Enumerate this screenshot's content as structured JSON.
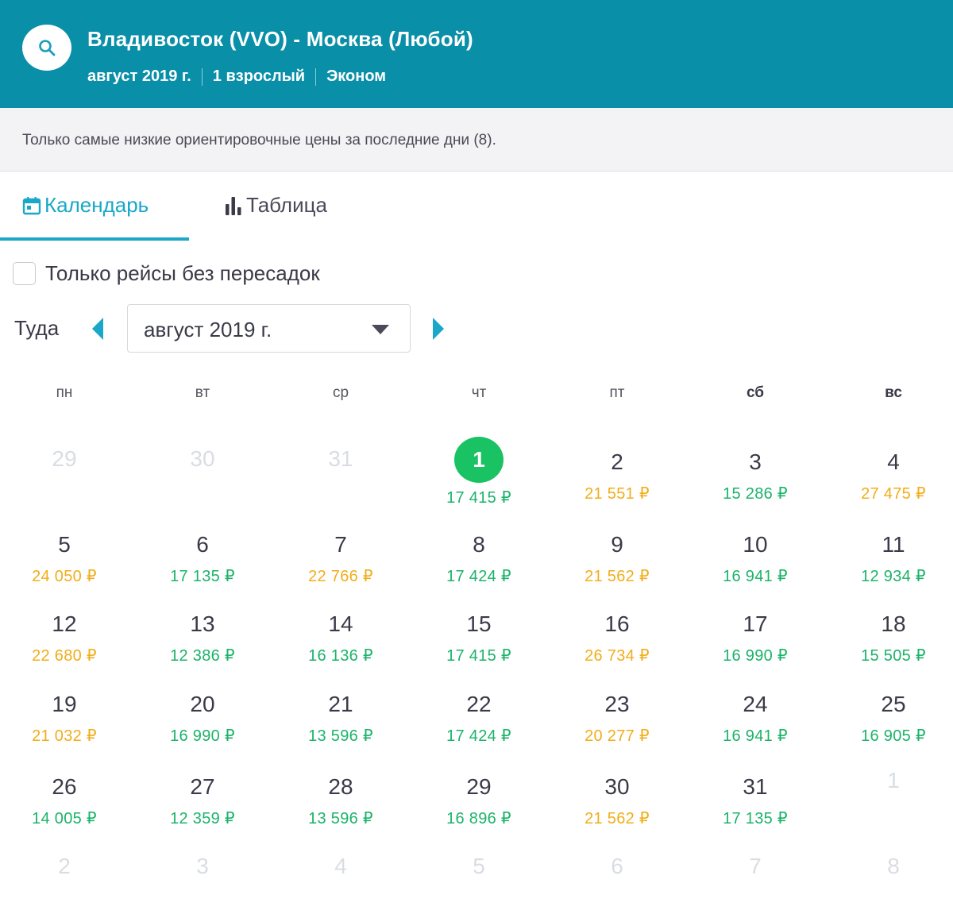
{
  "header": {
    "route": "Владивосток (VVO) - Москва (Любой)",
    "month": "август 2019 г.",
    "passengers": "1 взрослый",
    "cabin": "Эконом",
    "color": "#0a8fa8"
  },
  "notice": "Только самые низкие ориентировочные цены за последние дни (8).",
  "tabs": {
    "calendar": "Календарь",
    "table": "Таблица",
    "active": "calendar"
  },
  "direct_only": {
    "label": "Только рейсы без пересадок",
    "checked": false
  },
  "direction": {
    "label": "Туда",
    "month_value": "август 2019 г."
  },
  "weekdays": [
    "пн",
    "вт",
    "ср",
    "чт",
    "пт",
    "сб",
    "вс"
  ],
  "calendar": {
    "lead_days": [
      "29",
      "30",
      "31"
    ],
    "days": [
      {
        "day": "1",
        "price": "17 415 ₽",
        "tone": "green",
        "selected": true
      },
      {
        "day": "2",
        "price": "21 551 ₽",
        "tone": "orange"
      },
      {
        "day": "3",
        "price": "15 286 ₽",
        "tone": "green"
      },
      {
        "day": "4",
        "price": "27 475 ₽",
        "tone": "orange"
      },
      {
        "day": "5",
        "price": "24 050 ₽",
        "tone": "orange"
      },
      {
        "day": "6",
        "price": "17 135 ₽",
        "tone": "green"
      },
      {
        "day": "7",
        "price": "22 766 ₽",
        "tone": "orange"
      },
      {
        "day": "8",
        "price": "17 424 ₽",
        "tone": "green"
      },
      {
        "day": "9",
        "price": "21 562 ₽",
        "tone": "orange"
      },
      {
        "day": "10",
        "price": "16 941 ₽",
        "tone": "green"
      },
      {
        "day": "11",
        "price": "12 934 ₽",
        "tone": "green"
      },
      {
        "day": "12",
        "price": "22 680 ₽",
        "tone": "orange"
      },
      {
        "day": "13",
        "price": "12 386 ₽",
        "tone": "green"
      },
      {
        "day": "14",
        "price": "16 136 ₽",
        "tone": "green"
      },
      {
        "day": "15",
        "price": "17 415 ₽",
        "tone": "green"
      },
      {
        "day": "16",
        "price": "26 734 ₽",
        "tone": "orange"
      },
      {
        "day": "17",
        "price": "16 990 ₽",
        "tone": "green"
      },
      {
        "day": "18",
        "price": "15 505 ₽",
        "tone": "green"
      },
      {
        "day": "19",
        "price": "21 032 ₽",
        "tone": "orange"
      },
      {
        "day": "20",
        "price": "16 990 ₽",
        "tone": "green"
      },
      {
        "day": "21",
        "price": "13 596 ₽",
        "tone": "green"
      },
      {
        "day": "22",
        "price": "17 424 ₽",
        "tone": "green"
      },
      {
        "day": "23",
        "price": "20 277 ₽",
        "tone": "orange"
      },
      {
        "day": "24",
        "price": "16 941 ₽",
        "tone": "green"
      },
      {
        "day": "25",
        "price": "16 905 ₽",
        "tone": "green"
      },
      {
        "day": "26",
        "price": "14 005 ₽",
        "tone": "green"
      },
      {
        "day": "27",
        "price": "12 359 ₽",
        "tone": "green"
      },
      {
        "day": "28",
        "price": "13 596 ₽",
        "tone": "green"
      },
      {
        "day": "29",
        "price": "16 896 ₽",
        "tone": "green"
      },
      {
        "day": "30",
        "price": "21 562 ₽",
        "tone": "orange"
      },
      {
        "day": "31",
        "price": "17 135 ₽",
        "tone": "green"
      }
    ],
    "trail_days": [
      "1",
      "2",
      "3",
      "4",
      "5",
      "6",
      "7",
      "8"
    ],
    "colors": {
      "cheap": "#1bb36a",
      "expensive": "#f2ad1a",
      "selected": "#19c263"
    }
  }
}
